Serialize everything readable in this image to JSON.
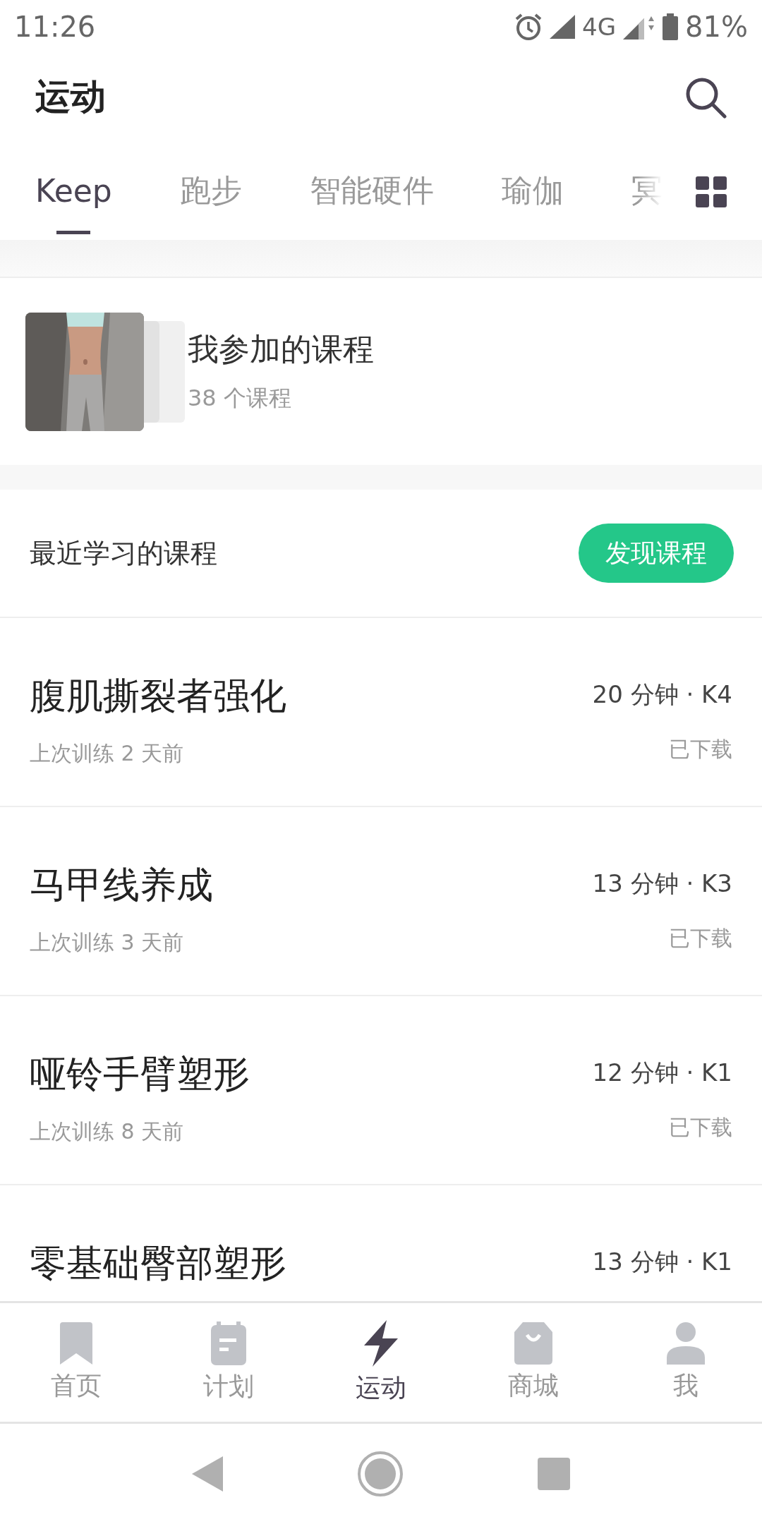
{
  "status_bar": {
    "time": "11:26",
    "network": "4G",
    "battery": "81%"
  },
  "header": {
    "title": "运动"
  },
  "tabs": [
    {
      "label": "Keep",
      "selected": true
    },
    {
      "label": "跑步",
      "selected": false
    },
    {
      "label": "智能硬件",
      "selected": false
    },
    {
      "label": "瑜伽",
      "selected": false
    },
    {
      "label": "冥",
      "selected": false
    }
  ],
  "my_courses": {
    "kind": "picture",
    "title": "我参加的课程",
    "subtitle": "38 个课程"
  },
  "recent": {
    "heading": "最近学习的课程",
    "button": "发现课程"
  },
  "courses": [
    {
      "title": "腹肌撕裂者强化",
      "last_trained": "上次训练 2 天前",
      "meta": "20 分钟 · K4",
      "status": "已下载"
    },
    {
      "title": "马甲线养成",
      "last_trained": "上次训练 3 天前",
      "meta": "13 分钟 · K3",
      "status": "已下载"
    },
    {
      "title": "哑铃手臂塑形",
      "last_trained": "上次训练 8 天前",
      "meta": "12 分钟 · K1",
      "status": "已下载"
    },
    {
      "title": "零基础臀部塑形",
      "meta": "13 分钟 · K1"
    }
  ],
  "bottom_nav": [
    {
      "label": "首页",
      "kind": "bookmark",
      "selected": false
    },
    {
      "label": "计划",
      "kind": "clipboard",
      "selected": false
    },
    {
      "label": "运动",
      "kind": "bolt",
      "selected": true
    },
    {
      "label": "商城",
      "kind": "bag",
      "selected": false
    },
    {
      "label": "我",
      "kind": "person",
      "selected": false
    }
  ]
}
